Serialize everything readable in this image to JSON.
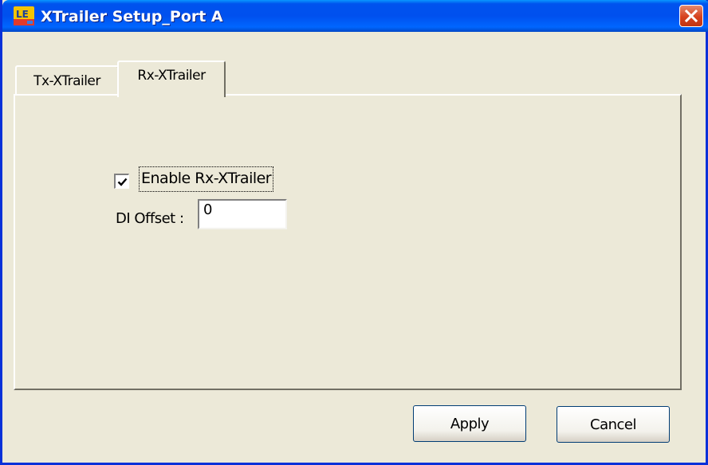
{
  "window": {
    "title": "XTrailer Setup_Port A",
    "icon": "le-app-icon",
    "close_icon": "close-x-icon",
    "accent_color": "#0054E3",
    "close_color": "#D6411E"
  },
  "tabs": [
    {
      "label": "Tx-XTrailer",
      "selected": false
    },
    {
      "label": "Rx-XTrailer",
      "selected": true
    }
  ],
  "panel": {
    "enable_checkbox": {
      "label": "Enable Rx-XTrailer",
      "checked": true
    },
    "offset_field": {
      "label": "DI Offset :",
      "value": "0"
    }
  },
  "buttons": {
    "apply": "Apply",
    "cancel": "Cancel"
  }
}
